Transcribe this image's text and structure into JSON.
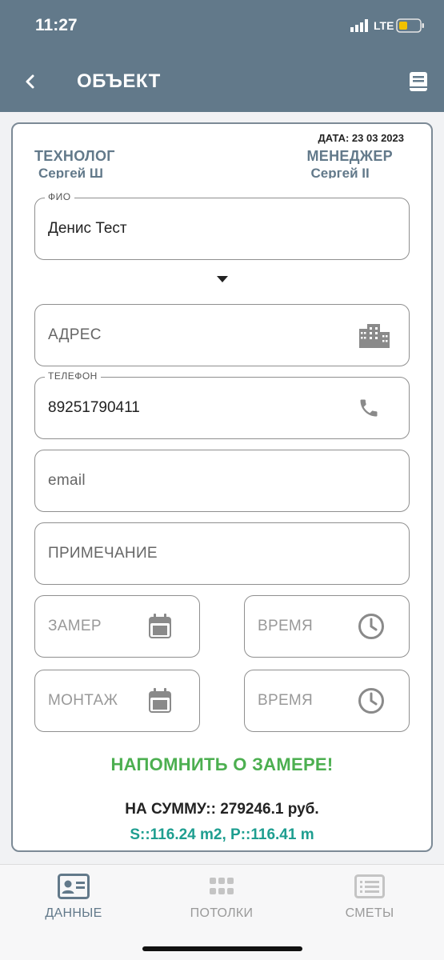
{
  "status_bar": {
    "time": "11:27",
    "network": "LTE"
  },
  "header": {
    "title": "ОБЪЕКТ"
  },
  "card": {
    "date": "ДАТА: 23 03 2023",
    "technologist": {
      "title": "ТЕХНОЛОГ",
      "name": "Сергей Ш"
    },
    "manager": {
      "title": "МЕНЕДЖЕР",
      "name": "Сергей II"
    },
    "fio": {
      "label": "ФИО",
      "value": "Денис Тест"
    },
    "address": {
      "placeholder": "АДРЕС"
    },
    "phone": {
      "label": "ТЕЛЕФОН",
      "value": "89251790411"
    },
    "email": {
      "placeholder": "email"
    },
    "note": {
      "placeholder": "ПРИМЕЧАНИЕ"
    },
    "measure": {
      "placeholder": "ЗАМЕР"
    },
    "measure_time": {
      "placeholder": "ВРЕМЯ"
    },
    "install": {
      "placeholder": "МОНТАЖ"
    },
    "install_time": {
      "placeholder": "ВРЕМЯ"
    },
    "remind_label": "НАПОМНИТЬ О ЗАМЕРЕ!",
    "sum_text": "НА СУММУ:: 279246.1 руб.",
    "area_text": "S::116.24 m2, P::116.41 m"
  },
  "bottom_nav": {
    "items": [
      {
        "label": "ДАННЫЕ",
        "icon": "contact-card-icon",
        "active": true
      },
      {
        "label": "ПОТОЛКИ",
        "icon": "grid-dots-icon",
        "active": false
      },
      {
        "label": "СМЕТЫ",
        "icon": "list-icon",
        "active": false
      }
    ]
  },
  "colors": {
    "header": "#62798a",
    "accent_green": "#4caf50",
    "accent_teal": "#1e9e90",
    "battery": "#f2c200"
  }
}
